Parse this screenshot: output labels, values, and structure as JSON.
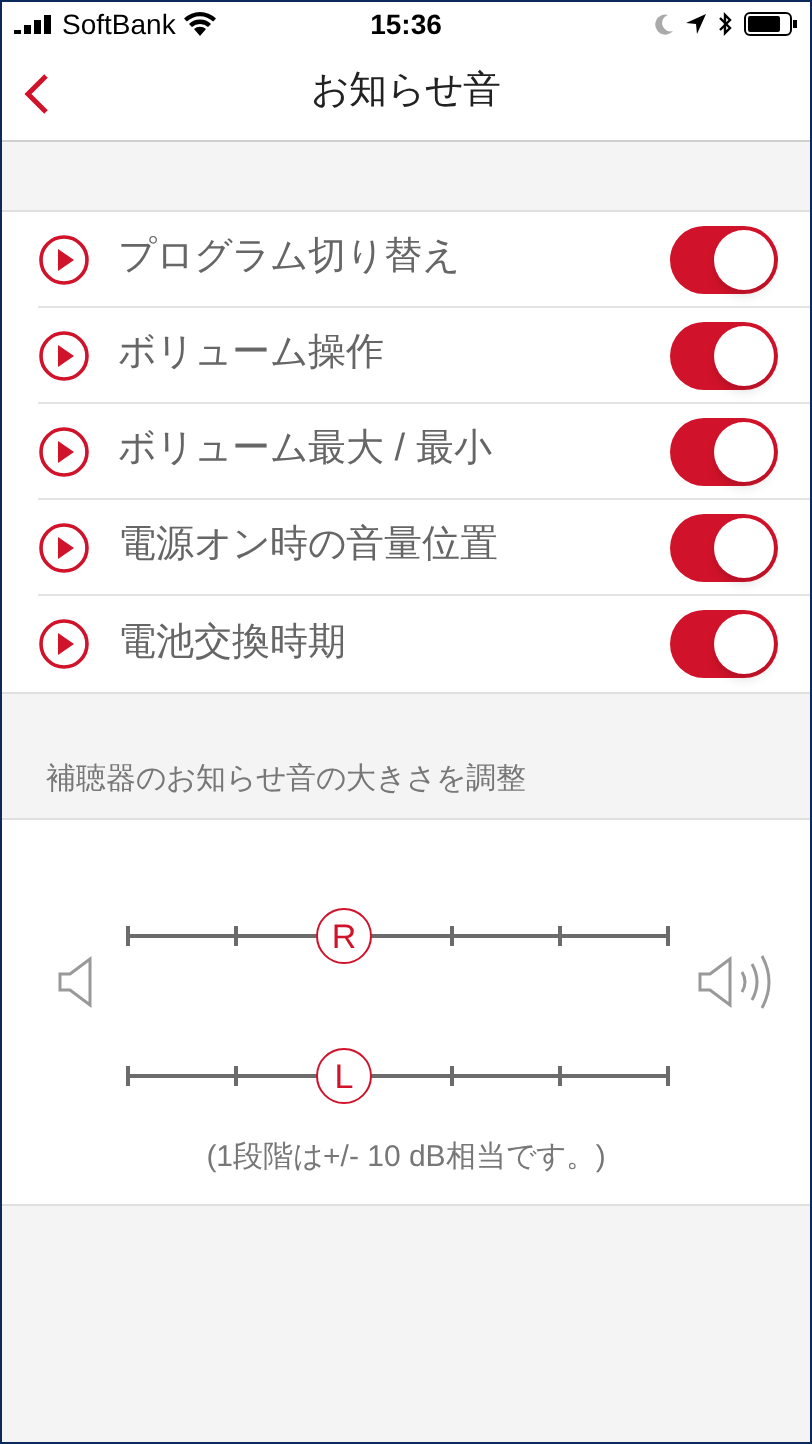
{
  "status_bar": {
    "carrier": "SoftBank",
    "time": "15:36"
  },
  "nav": {
    "title": "お知らせ音"
  },
  "sounds": [
    {
      "label": "プログラム切り替え",
      "on": true
    },
    {
      "label": "ボリューム操作",
      "on": true
    },
    {
      "label": "ボリューム最大 / 最小",
      "on": true
    },
    {
      "label": "電源オン時の音量位置",
      "on": true
    },
    {
      "label": "電池交換時期",
      "on": true
    }
  ],
  "volume_section": {
    "header": "補聴器のお知らせ音の大きさを調整",
    "sliders": [
      {
        "thumb": "R",
        "level": 0.4
      },
      {
        "thumb": "L",
        "level": 0.4
      }
    ],
    "note": "(1段階は+/- 10 dB相当です。)"
  }
}
